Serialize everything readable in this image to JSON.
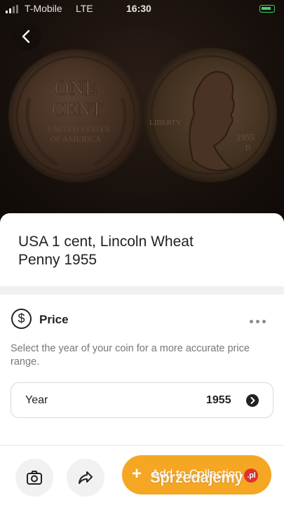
{
  "status_bar": {
    "carrier": "T-Mobile",
    "network": "LTE",
    "time": "16:30"
  },
  "hero": {
    "back_icon": "chevron-left-icon",
    "reverse_text": {
      "line1": "ONE",
      "line2": "CENT",
      "line3": "UNITED STATES",
      "line4": "OF AMERICA"
    },
    "obverse_text": {
      "legend": "LIBERTY",
      "year": "1955",
      "mint": "D"
    }
  },
  "coin": {
    "title": "USA 1 cent, Lincoln Wheat Penny 1955"
  },
  "price": {
    "icon": "dollar-circle-icon",
    "icon_glyph": "$",
    "title": "Price",
    "more_icon": "more-dots-icon",
    "description": "Select the year of your coin for a more accurate price range.",
    "year_label": "Year",
    "year_value": "1955",
    "chevron_icon": "chevron-right-circle-icon"
  },
  "actions": {
    "camera_icon": "camera-icon",
    "share_icon": "share-icon",
    "add_plus": "+",
    "add_label": "Add to Collection"
  },
  "watermark": {
    "text": "Sprzedajemy",
    "suffix": ".pl"
  },
  "colors": {
    "accent": "#f5a623",
    "text": "#222222",
    "muted": "#777777",
    "battery": "#3fd26a"
  }
}
